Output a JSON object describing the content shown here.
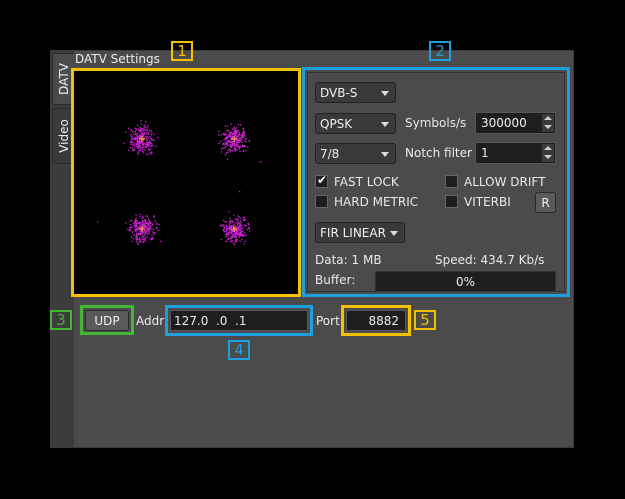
{
  "tabs": {
    "datv": "DATV",
    "video": "Video"
  },
  "title": "DATV Settings",
  "callouts": {
    "c1": "1",
    "c2": "2",
    "c3": "3",
    "c4": "4",
    "c5": "5"
  },
  "settings": {
    "standard": "DVB-S",
    "modulation": "QPSK",
    "fec": "7/8",
    "symbols_label": "Symbols/s",
    "symbols_value": "300000",
    "notch_label": "Notch filter",
    "notch_value": "1",
    "fast_lock_label": "FAST LOCK",
    "fast_lock_checked": true,
    "allow_drift_label": "ALLOW DRIFT",
    "hard_metric_label": "HARD METRIC",
    "viterbi_label": "VITERBI",
    "reset_label": "R",
    "filter": "FIR LINEAR",
    "data_label": "Data: 1 MB",
    "speed_label": "Speed: 434.7 Kb/s",
    "buffer_label": "Buffer:",
    "buffer_value": "0%"
  },
  "udp": {
    "udp_label": "UDP",
    "addr_label": "Addr",
    "addr_value": "127.0  .0  .1",
    "port_label": "Port",
    "port_value": "8882"
  },
  "colors": {
    "yellow": "#f2c200",
    "blue": "#1e9fe0",
    "green": "#44b535",
    "constellation": "#d020d8"
  }
}
